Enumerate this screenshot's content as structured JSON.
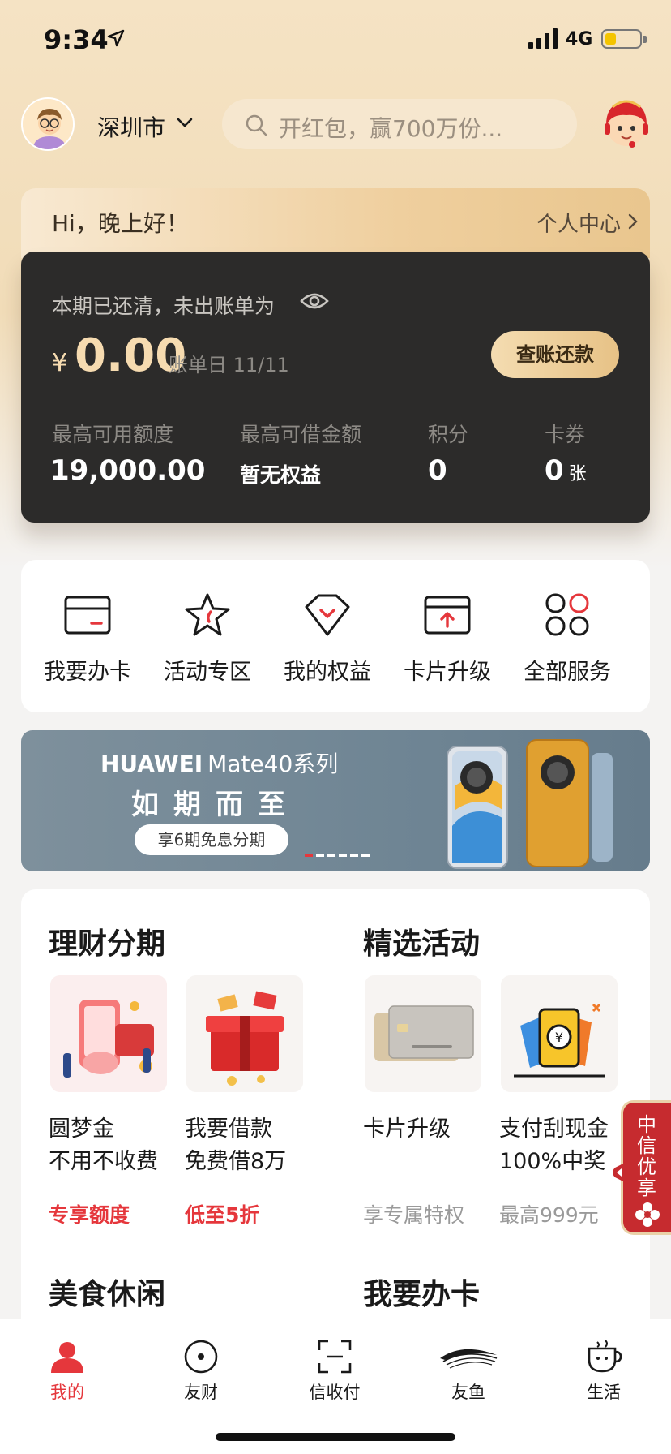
{
  "status_bar": {
    "time": "9:34",
    "network": "4G"
  },
  "header": {
    "city": "深圳市",
    "search_placeholder": "开红包，赢700万份..."
  },
  "greeting": {
    "text": "Hi，晚上好！",
    "center_link": "个人中心"
  },
  "card": {
    "status_text": "本期已还清，未出账单为",
    "currency": "¥",
    "amount": "0.00",
    "bill_day": "账单日 11/11",
    "pay_button": "查账还款",
    "stats": [
      {
        "label": "最高可用额度",
        "value": "19,000.00"
      },
      {
        "label": "最高可借金额",
        "value": "暂无权益"
      },
      {
        "label": "积分",
        "value": "0"
      },
      {
        "label": "卡券",
        "value": "0",
        "unit": "张"
      }
    ]
  },
  "quick_services": [
    {
      "label": "我要办卡",
      "icon": "card-icon"
    },
    {
      "label": "活动专区",
      "icon": "star-icon"
    },
    {
      "label": "我的权益",
      "icon": "diamond-icon"
    },
    {
      "label": "卡片升级",
      "icon": "card-upgrade-icon"
    },
    {
      "label": "全部服务",
      "icon": "grid-icon"
    }
  ],
  "banner": {
    "brand": "HUAWEI",
    "model": "Mate40系列",
    "slogan": "如期而至",
    "pill": "享6期免息分期"
  },
  "sections": {
    "finance_title": "理财分期",
    "activity_title": "精选活动",
    "food_title": "美食休闲",
    "card_title": "我要办卡",
    "tiles": [
      {
        "name1": "圆梦金",
        "name2": "不用不收费",
        "tag": "专享额度",
        "tag_style": "red"
      },
      {
        "name1": "我要借款",
        "name2": "免费借8万",
        "tag": "低至5折",
        "tag_style": "red"
      },
      {
        "name1": "卡片升级",
        "name2": "",
        "tag": "享专属特权",
        "tag_style": "grey"
      },
      {
        "name1": "支付刮现金",
        "name2": "100%中奖",
        "tag": "最高999元",
        "tag_style": "grey"
      }
    ]
  },
  "float_tab": {
    "text": "中信优享"
  },
  "bottom_nav": [
    {
      "label": "我的",
      "icon": "user-icon",
      "active": true
    },
    {
      "label": "友财",
      "icon": "coin-icon",
      "active": false
    },
    {
      "label": "信收付",
      "icon": "scan-icon",
      "active": false
    },
    {
      "label": "友鱼",
      "icon": "fish-icon",
      "active": false
    },
    {
      "label": "生活",
      "icon": "cup-icon",
      "active": false
    }
  ],
  "colors": {
    "accent_red": "#e5373c",
    "gold": "#f6dbb0",
    "card_dark": "#2c2b2a",
    "banner_blue": "#6f8594"
  }
}
